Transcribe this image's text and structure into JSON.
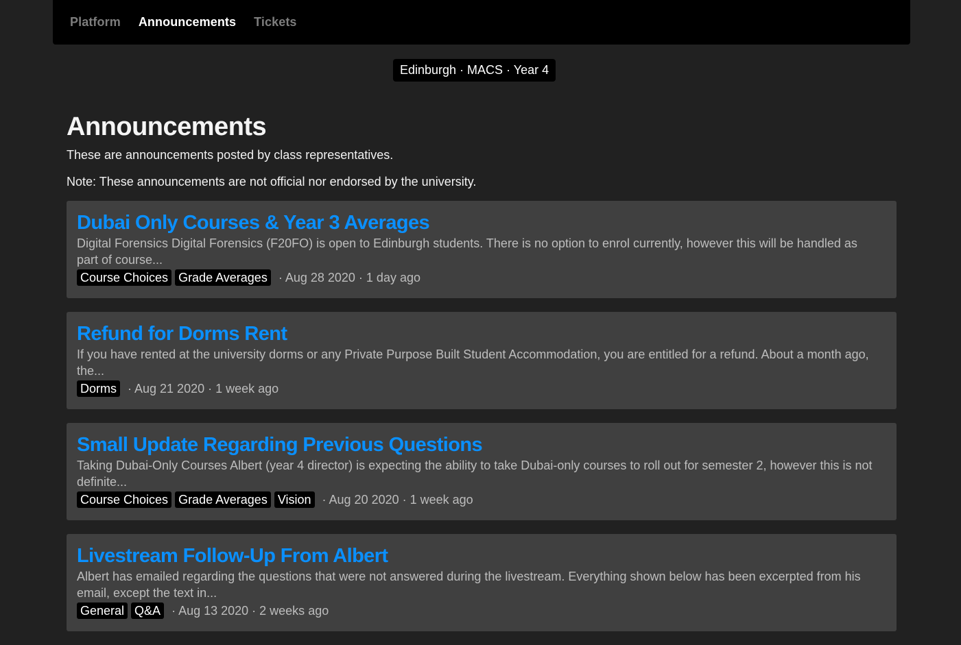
{
  "nav": {
    "links": [
      {
        "label": "Platform",
        "active": false
      },
      {
        "label": "Announcements",
        "active": true
      },
      {
        "label": "Tickets",
        "active": false
      }
    ]
  },
  "context": {
    "label": "Edinburgh · MACS · Year 4"
  },
  "page": {
    "title": "Announcements",
    "subtitle": "These are announcements posted by class representatives.",
    "note": "Note: These announcements are not official nor endorsed by the university."
  },
  "colors": {
    "background": "#212121",
    "card": "#404040",
    "accent": "#0a90ff",
    "navbar": "#000000"
  },
  "announcements": [
    {
      "title": "Dubai Only Courses & Year 3 Averages",
      "excerpt": "Digital Forensics Digital Forensics (F20FO) is open to Edinburgh students. There is no option to enrol currently, however this will be handled as part of course...",
      "tags": [
        "Course Choices",
        "Grade Averages"
      ],
      "meta": "· Aug 28 2020 · 1 day ago"
    },
    {
      "title": "Refund for Dorms Rent",
      "excerpt": "If you have rented at the university dorms or any Private Purpose Built Student Accommodation, you are entitled for a refund. About a month ago, the...",
      "tags": [
        "Dorms"
      ],
      "meta": "· Aug 21 2020 · 1 week ago"
    },
    {
      "title": "Small Update Regarding Previous Questions",
      "excerpt": "Taking Dubai-Only Courses Albert (year 4 director) is expecting the ability to take Dubai-only courses to roll out for semester 2, however this is not definite...",
      "tags": [
        "Course Choices",
        "Grade Averages",
        "Vision"
      ],
      "meta": "· Aug 20 2020 · 1 week ago"
    },
    {
      "title": "Livestream Follow-Up From Albert",
      "excerpt": "Albert has emailed regarding the questions that were not answered during the livestream. Everything shown below has been excerpted from his email, except the text in...",
      "tags": [
        "General",
        "Q&A"
      ],
      "meta": "· Aug 13 2020 · 2 weeks ago"
    }
  ]
}
